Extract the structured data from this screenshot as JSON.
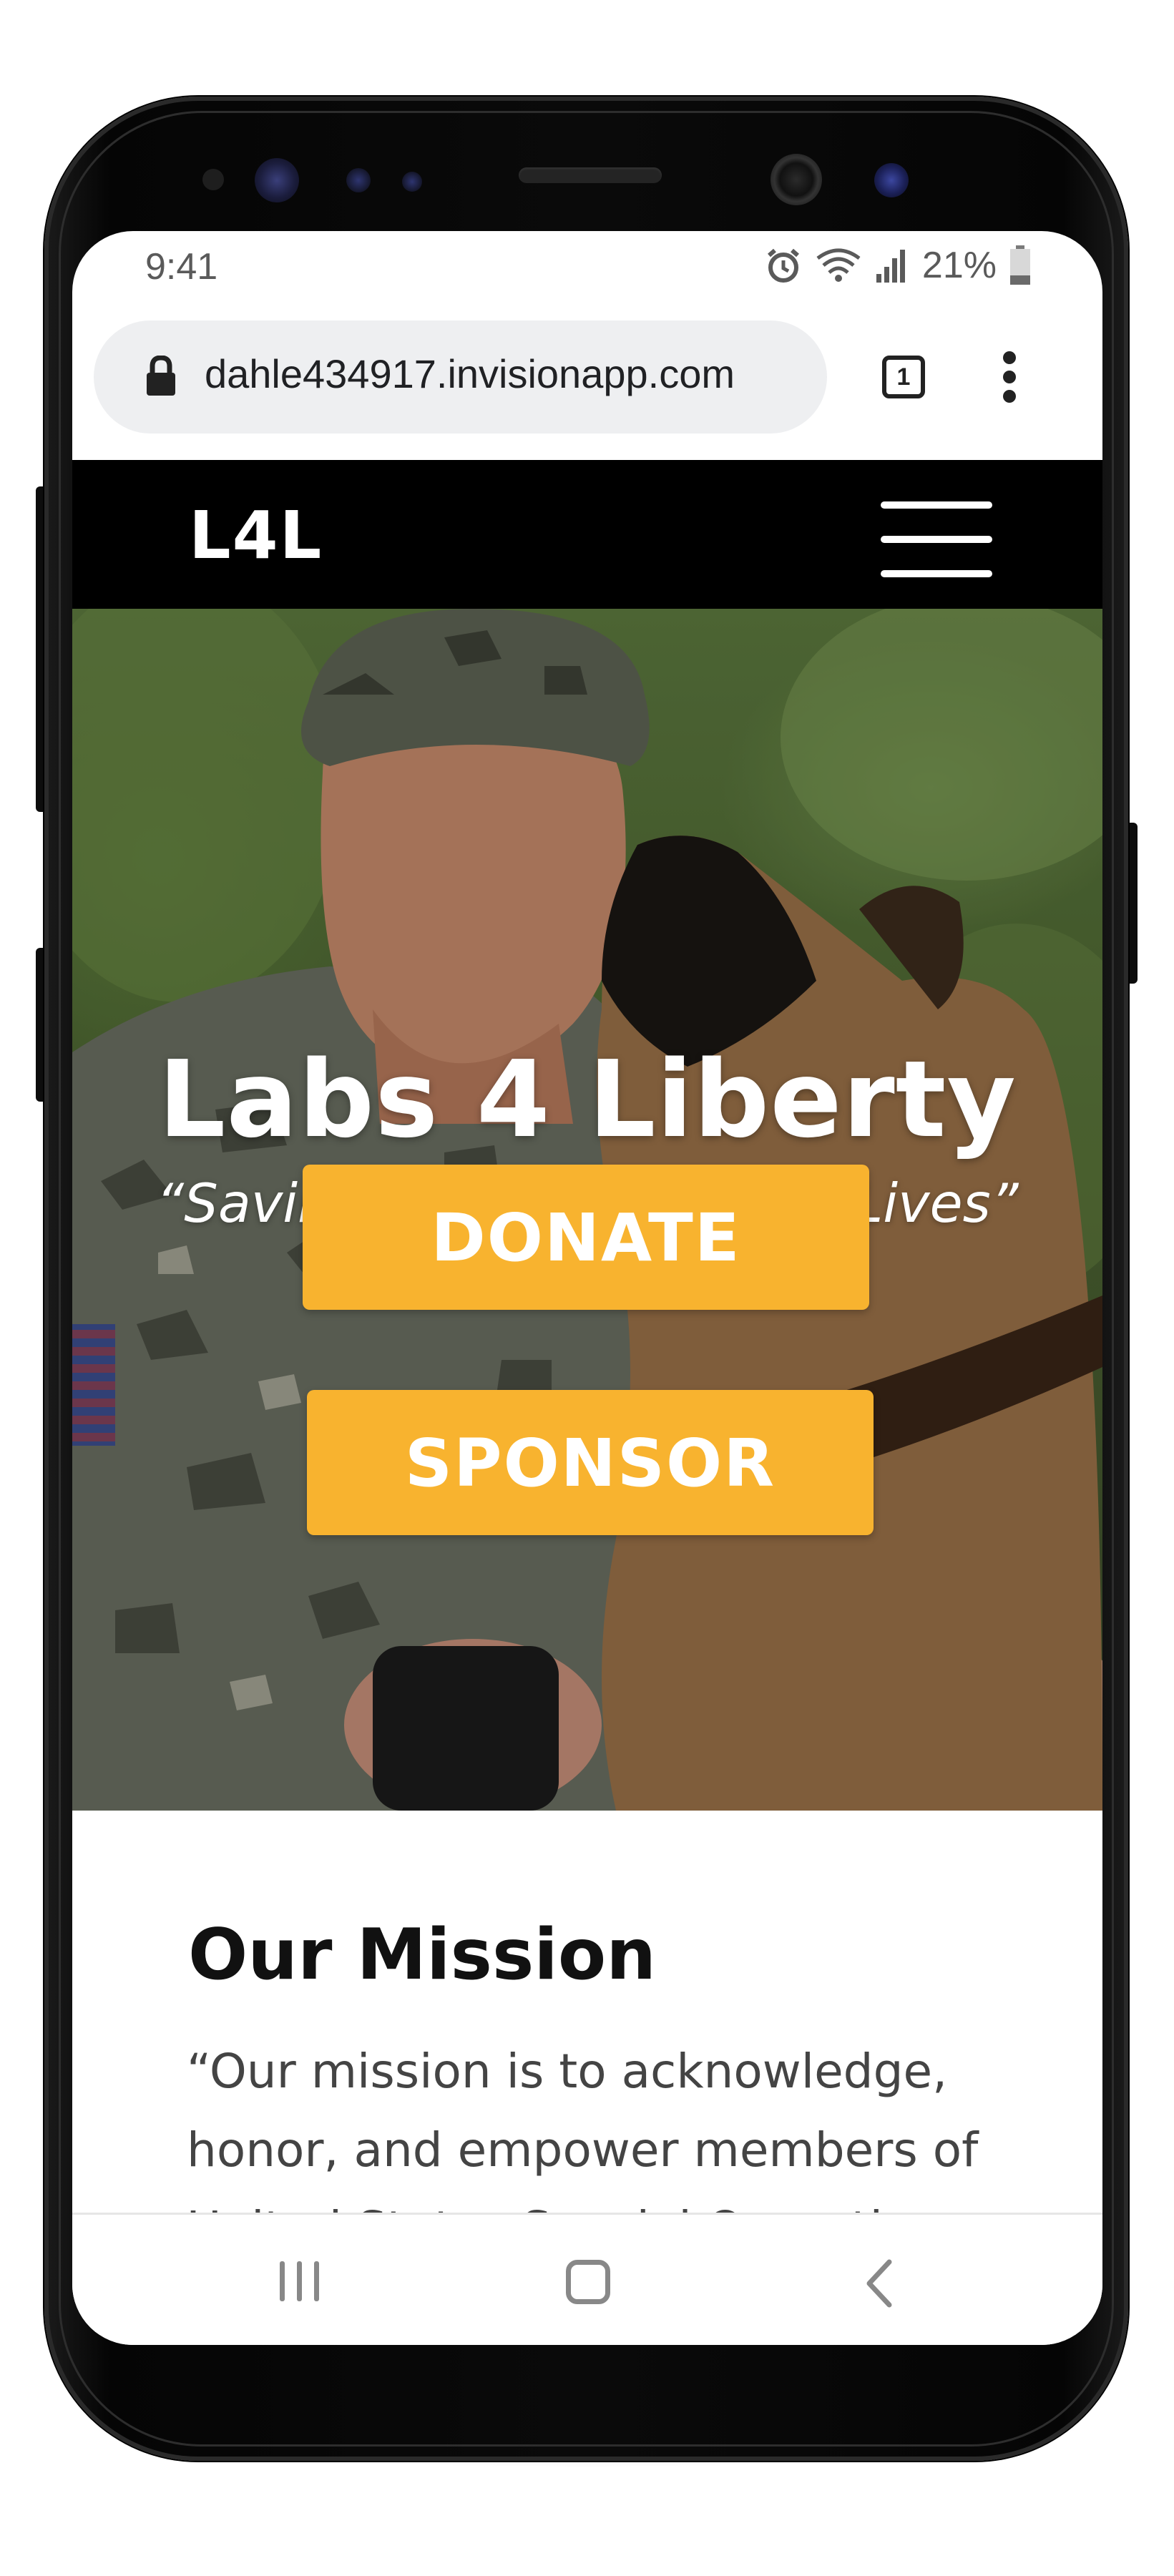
{
  "status_bar": {
    "time": "9:41",
    "battery_percent": "21%",
    "icons": [
      "alarm-icon",
      "wifi-icon",
      "signal-icon",
      "battery-icon"
    ]
  },
  "browser": {
    "url": "dahle434917.invisionapp.com",
    "tab_count": "1",
    "lock_icon": "lock-icon",
    "menu_icon": "more-vert-icon"
  },
  "site_nav": {
    "logo": "L4L",
    "menu_icon": "hamburger-menu-icon"
  },
  "hero": {
    "title": "Labs 4 Liberty",
    "subtitle": "“Saving Veterans, Saving Lives”",
    "primary_button": "DONATE",
    "secondary_button": "SPONSOR"
  },
  "mission": {
    "heading": "Our Mission",
    "body": "“Our mission is to acknowledge, honor, and empower members of United States Special Operations"
  },
  "android_nav": {
    "recents_icon": "recents-icon",
    "home_icon": "home-icon",
    "back_icon": "back-icon"
  },
  "colors": {
    "accent": "#f8b32f",
    "nav_background": "#000000",
    "text_dark": "#111111"
  }
}
